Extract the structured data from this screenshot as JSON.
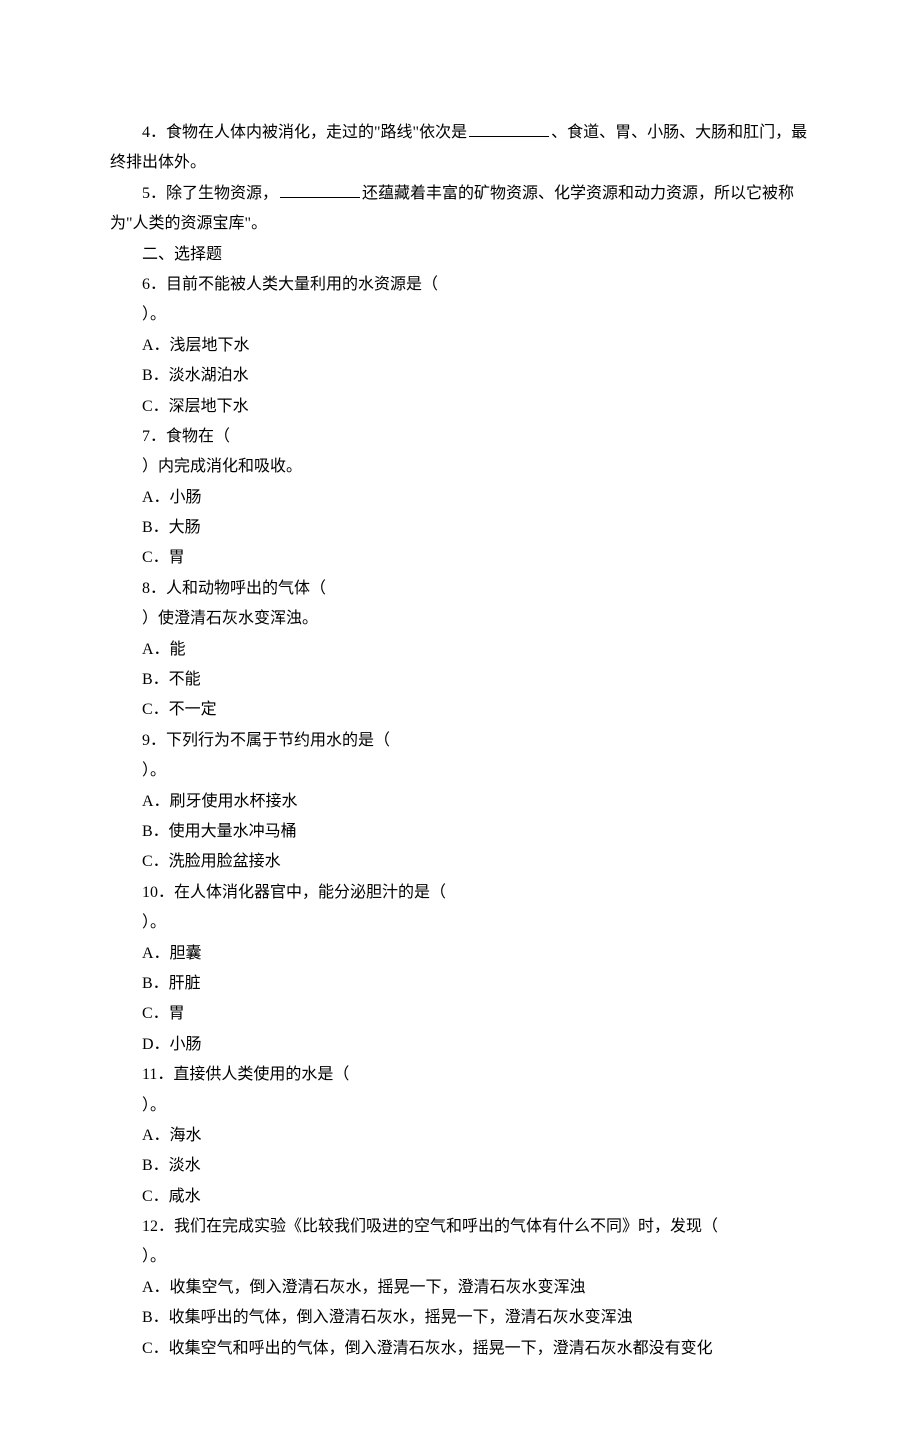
{
  "q4": {
    "prefix": "4．食物在人体内被消化，走过的\"路线\"依次是",
    "suffix": "、食道、胃、小肠、大肠和肛门，最终排出体外。"
  },
  "q5": {
    "prefix": "5．除了生物资源，",
    "suffix": "还蕴藏着丰富的矿物资源、化学资源和动力资源，所以它被称为\"人类的资源宝库\"。"
  },
  "section2": "二、选择题",
  "q6": {
    "stem": "6．目前不能被人类大量利用的水资源是（",
    "close": "）。",
    "A": "A．浅层地下水",
    "B": "B．淡水湖泊水",
    "C": "C．深层地下水"
  },
  "q7": {
    "stem": "7．食物在（",
    "close": "）内完成消化和吸收。",
    "A": "A．小肠",
    "B": "B．大肠",
    "C": "C．胃"
  },
  "q8": {
    "stem": "8．人和动物呼出的气体（",
    "close": "）使澄清石灰水变浑浊。",
    "A": "A．能",
    "B": "B．不能",
    "C": "C．不一定"
  },
  "q9": {
    "stem": "9．下列行为不属于节约用水的是（",
    "close": "）。",
    "A": "A．刷牙使用水杯接水",
    "B": "B．使用大量水冲马桶",
    "C": "C．洗脸用脸盆接水"
  },
  "q10": {
    "stem": "10．在人体消化器官中，能分泌胆汁的是（",
    "close": "）。",
    "A": "A．胆囊",
    "B": "B．肝脏",
    "C": "C．胃",
    "D": "D．小肠"
  },
  "q11": {
    "stem": "11．直接供人类使用的水是（",
    "close": "）。",
    "A": "A．海水",
    "B": "B．淡水",
    "C": "C．咸水"
  },
  "q12": {
    "stem": "12．我们在完成实验《比较我们吸进的空气和呼出的气体有什么不同》时，发现（",
    "close": "）。",
    "A": "A．收集空气，倒入澄清石灰水，摇晃一下，澄清石灰水变浑浊",
    "B": "B．收集呼出的气体，倒入澄清石灰水，摇晃一下，澄清石灰水变浑浊",
    "C": "C．收集空气和呼出的气体，倒入澄清石灰水，摇晃一下，澄清石灰水都没有变化"
  }
}
